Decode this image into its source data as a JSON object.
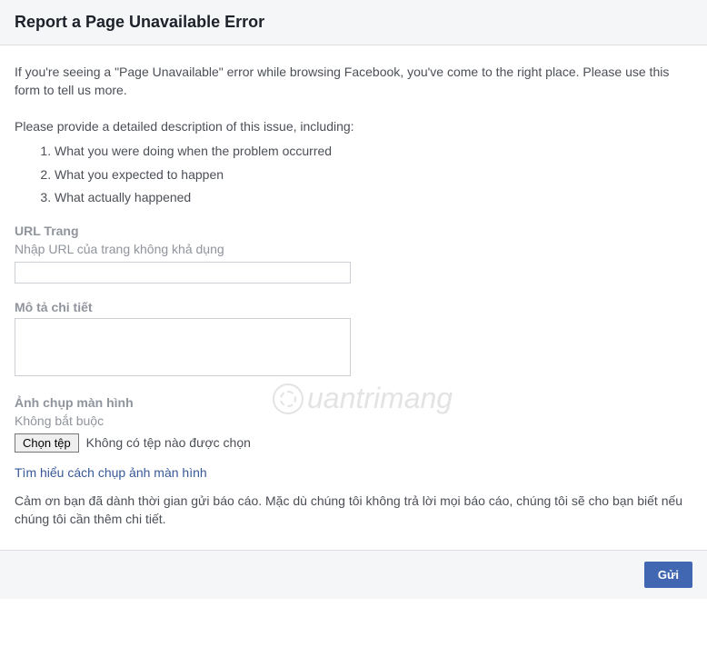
{
  "header": {
    "title": "Report a Page Unavailable Error"
  },
  "intro": "If you're seeing a \"Page Unavailable\" error while browsing Facebook, you've come to the right place. Please use this form to tell us more.",
  "instructions": {
    "lead": "Please provide a detailed description of this issue, including:",
    "items": [
      "What you were doing when the problem occurred",
      "What you expected to happen",
      "What actually happened"
    ]
  },
  "form": {
    "url": {
      "label": "URL Trang",
      "sublabel": "Nhập URL của trang không khả dụng",
      "value": ""
    },
    "description": {
      "label": "Mô tả chi tiết",
      "value": ""
    },
    "screenshot": {
      "label": "Ảnh chụp màn hình",
      "sublabel": "Không bắt buộc",
      "button": "Chọn tệp",
      "status": "Không có tệp nào được chọn"
    },
    "help_link": "Tìm hiểu cách chụp ảnh màn hình",
    "thanks": "Cảm ơn bạn đã dành thời gian gửi báo cáo. Mặc dù chúng tôi không trả lời mọi báo cáo, chúng tôi sẽ cho bạn biết nếu chúng tôi cần thêm chi tiết."
  },
  "footer": {
    "submit": "Gửi"
  },
  "watermark": "uantrimang"
}
